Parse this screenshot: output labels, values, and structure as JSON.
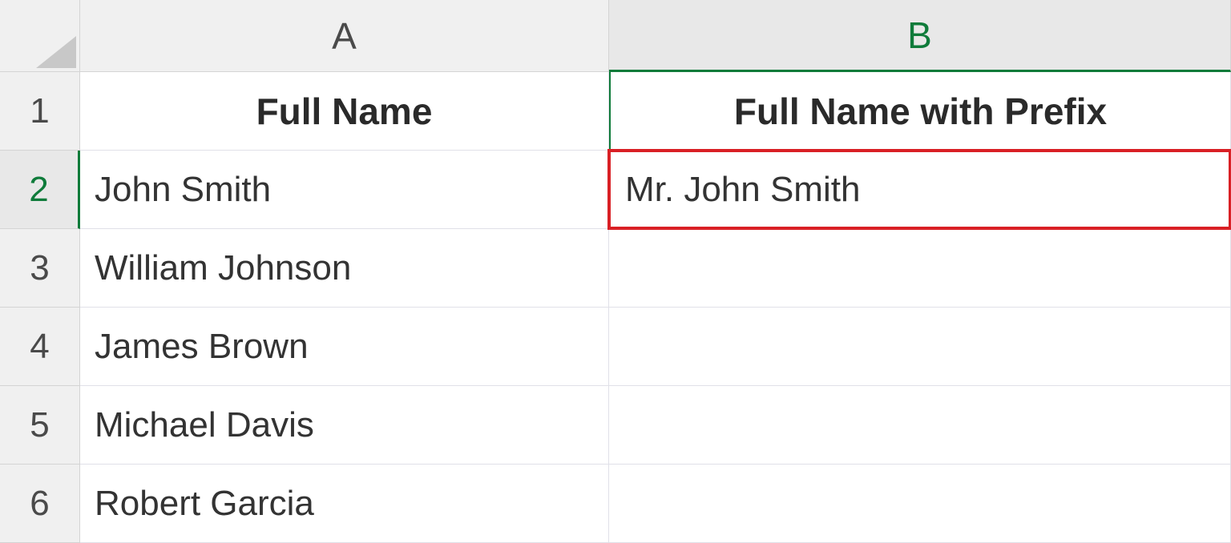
{
  "columns": [
    "A",
    "B"
  ],
  "rowNumbers": [
    "1",
    "2",
    "3",
    "4",
    "5",
    "6"
  ],
  "headers": {
    "A": "Full Name",
    "B": "Full Name with Prefix"
  },
  "data": {
    "A2": "John Smith",
    "B2": "Mr. John Smith",
    "A3": "William Johnson",
    "B3": "",
    "A4": "James Brown",
    "B4": "",
    "A5": "Michael Davis",
    "B5": "",
    "A6": "Robert Garcia",
    "B6": ""
  },
  "selectedColumn": "B",
  "selectedRow": "2",
  "highlightedCell": "B2"
}
